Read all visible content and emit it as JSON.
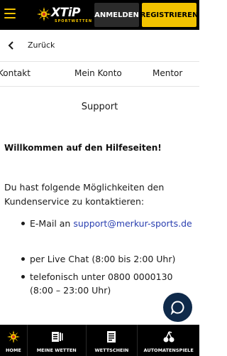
{
  "header": {
    "logo_text": "XTiP",
    "logo_sub": "SPORTWETTEN",
    "login_label": "ANMELDEN",
    "register_label": "REGISTRIEREN",
    "accent_color": "#f3c300"
  },
  "back": {
    "label": "Zurück"
  },
  "tabs": [
    {
      "label": "Kontakt"
    },
    {
      "label": "Mein Konto"
    },
    {
      "label": "Mentor"
    }
  ],
  "content": {
    "title": "Support",
    "welcome": "Willkommen auf den Hilfeseiten!",
    "intro": "Du hast folgende Möglichkeiten den Kundenservice zu kontaktieren:",
    "options": [
      {
        "prefix": "E-Mail an ",
        "link": "support@merkur-sports.de"
      },
      {
        "text": "per Live Chat (8:00 bis 2:00 Uhr)"
      },
      {
        "text": "telefonisch unter 0800 0000130 (8:00 – 23:00 Uhr)"
      }
    ]
  },
  "chat": {
    "icon": "chat-bubble-icon"
  },
  "bottom_nav": [
    {
      "label": "HOME",
      "icon": "sun-logo-icon"
    },
    {
      "label": "MEINE WETTEN",
      "icon": "betslip-list-icon"
    },
    {
      "label": "WETTSCHEIN",
      "icon": "betslip-icon"
    },
    {
      "label": "AUTOMATENSPIELE",
      "icon": "cherries-icon"
    }
  ]
}
